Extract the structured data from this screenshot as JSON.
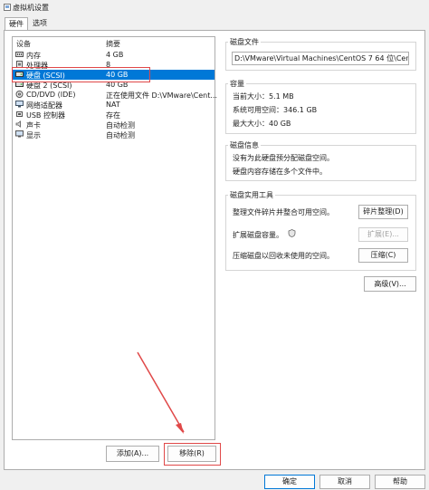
{
  "window": {
    "title": "虚拟机设置"
  },
  "tabs": [
    {
      "label": "硬件"
    },
    {
      "label": "选项"
    }
  ],
  "device_list": {
    "columns": [
      "设备",
      "摘要"
    ],
    "rows": [
      {
        "name": "内存",
        "summary": "4 GB",
        "icon": "memory-icon"
      },
      {
        "name": "处理器",
        "summary": "8",
        "icon": "cpu-icon"
      },
      {
        "name": "硬盘 (SCSI)",
        "summary": "40 GB",
        "icon": "hard-disk-icon",
        "selected": true
      },
      {
        "name": "硬盘 2 (SCSI)",
        "summary": "40 GB",
        "icon": "hard-disk-icon"
      },
      {
        "name": "CD/DVD (IDE)",
        "summary": "正在使用文件 D:\\VMware\\Cent...",
        "icon": "cd-dvd-icon"
      },
      {
        "name": "网络适配器",
        "summary": "NAT",
        "icon": "network-adapter-icon"
      },
      {
        "name": "USB 控制器",
        "summary": "存在",
        "icon": "usb-icon"
      },
      {
        "name": "声卡",
        "summary": "自动检测",
        "icon": "sound-card-icon"
      },
      {
        "name": "显示",
        "summary": "自动检测",
        "icon": "display-icon"
      }
    ],
    "add_button": "添加(A)...",
    "remove_button": "移除(R)"
  },
  "disk_file": {
    "title": "磁盘文件",
    "path": "D:\\VMware\\Virtual Machines\\CentOS 7 64 位\\CentOS 7"
  },
  "capacity": {
    "title": "容量",
    "current_size": "当前大小：5.1 MB",
    "system_free": "系统可用空间：346.1 GB",
    "max_size": "最大大小：40 GB"
  },
  "disk_info": {
    "title": "磁盘信息",
    "line1": "没有为此硬盘预分配磁盘空间。",
    "line2": "硬盘内容存储在多个文件中。"
  },
  "utilities": {
    "title": "磁盘实用工具",
    "defrag_desc": "整理文件碎片并整合可用空间。",
    "defrag_button": "碎片整理(D)",
    "expand_desc": "扩展磁盘容量。",
    "expand_button": "扩展(E)...",
    "compact_desc": "压缩磁盘以回收未使用的空间。",
    "compact_button": "压缩(C)",
    "advanced_button": "高级(V)..."
  },
  "footer": {
    "ok": "确定",
    "cancel": "取消",
    "help": "帮助"
  },
  "colors": {
    "selection": "#0078d7",
    "annotation": "#e04848"
  }
}
